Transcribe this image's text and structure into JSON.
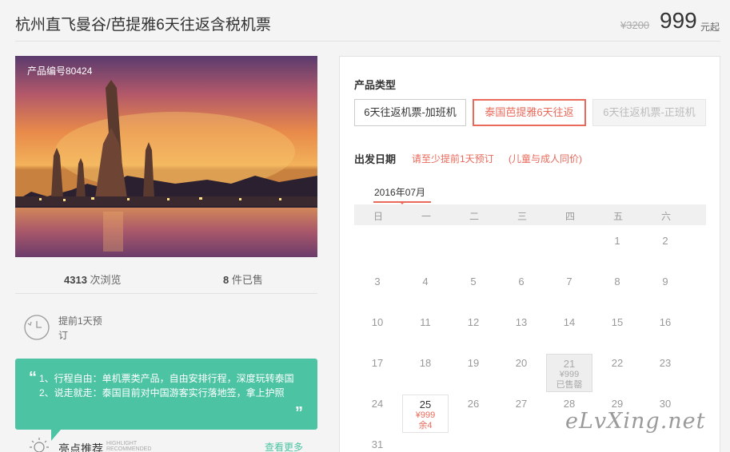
{
  "header": {
    "title": "杭州直飞曼谷/芭提雅6天往返含税机票",
    "old_price": "¥3200",
    "price": "999",
    "price_unit": "元起"
  },
  "photo": {
    "code": "产品编号80424"
  },
  "stats": {
    "views_num": "4313",
    "views_label": "次浏览",
    "sold_num": "8",
    "sold_label": "件已售"
  },
  "advance": {
    "text": "提前1天预订"
  },
  "highlights": {
    "line1": "1、行程自由：单机票类产品，自由安排行程，深度玩转泰国",
    "line2": "2、说走就走：泰国目前对中国游客实行落地签，拿上护照",
    "quote_open": "“",
    "quote_close": "”"
  },
  "recommend": {
    "title": "亮点推荐",
    "en1": "HIGHLIGHT",
    "en2": "RECOMMENDED",
    "more": "查看更多"
  },
  "booking": {
    "product_type_label": "产品类型",
    "options": [
      {
        "label": "6天往返机票-加班机",
        "state": "normal"
      },
      {
        "label": "泰国芭提雅6天往返",
        "state": "selected"
      },
      {
        "label": "6天往返机票-正班机",
        "state": "disabled"
      }
    ],
    "date_label": "出发日期",
    "date_note": "请至少提前1天预订",
    "date_note2": "(儿童与成人同价)",
    "month": "2016年07月",
    "weekdays": [
      "日",
      "一",
      "二",
      "三",
      "四",
      "五",
      "六"
    ],
    "days": [
      {
        "n": "1",
        "col": 5,
        "row": 0
      },
      {
        "n": "2",
        "col": 6,
        "row": 0
      },
      {
        "n": "3",
        "col": 0,
        "row": 1
      },
      {
        "n": "4",
        "col": 1,
        "row": 1
      },
      {
        "n": "5",
        "col": 2,
        "row": 1
      },
      {
        "n": "6",
        "col": 3,
        "row": 1
      },
      {
        "n": "7",
        "col": 4,
        "row": 1
      },
      {
        "n": "8",
        "col": 5,
        "row": 1
      },
      {
        "n": "9",
        "col": 6,
        "row": 1
      },
      {
        "n": "10",
        "col": 0,
        "row": 2
      },
      {
        "n": "11",
        "col": 1,
        "row": 2
      },
      {
        "n": "12",
        "col": 2,
        "row": 2
      },
      {
        "n": "13",
        "col": 3,
        "row": 2
      },
      {
        "n": "14",
        "col": 4,
        "row": 2
      },
      {
        "n": "15",
        "col": 5,
        "row": 2
      },
      {
        "n": "16",
        "col": 6,
        "row": 2
      },
      {
        "n": "17",
        "col": 0,
        "row": 3
      },
      {
        "n": "18",
        "col": 1,
        "row": 3
      },
      {
        "n": "19",
        "col": 2,
        "row": 3
      },
      {
        "n": "20",
        "col": 3,
        "row": 3
      },
      {
        "n": "21",
        "col": 4,
        "row": 3,
        "status": "soldout",
        "price": "¥999",
        "note": "已售罄"
      },
      {
        "n": "22",
        "col": 5,
        "row": 3
      },
      {
        "n": "23",
        "col": 6,
        "row": 3
      },
      {
        "n": "24",
        "col": 0,
        "row": 4
      },
      {
        "n": "25",
        "col": 1,
        "row": 4,
        "status": "available",
        "price": "¥999",
        "note": "余4"
      },
      {
        "n": "26",
        "col": 2,
        "row": 4
      },
      {
        "n": "27",
        "col": 3,
        "row": 4
      },
      {
        "n": "28",
        "col": 4,
        "row": 4
      },
      {
        "n": "29",
        "col": 5,
        "row": 4
      },
      {
        "n": "30",
        "col": 6,
        "row": 4
      },
      {
        "n": "31",
        "col": 0,
        "row": 5
      }
    ]
  },
  "watermark": "eLvXing.net",
  "colors": {
    "accent": "#e9695a",
    "green": "#4cc4a3"
  }
}
